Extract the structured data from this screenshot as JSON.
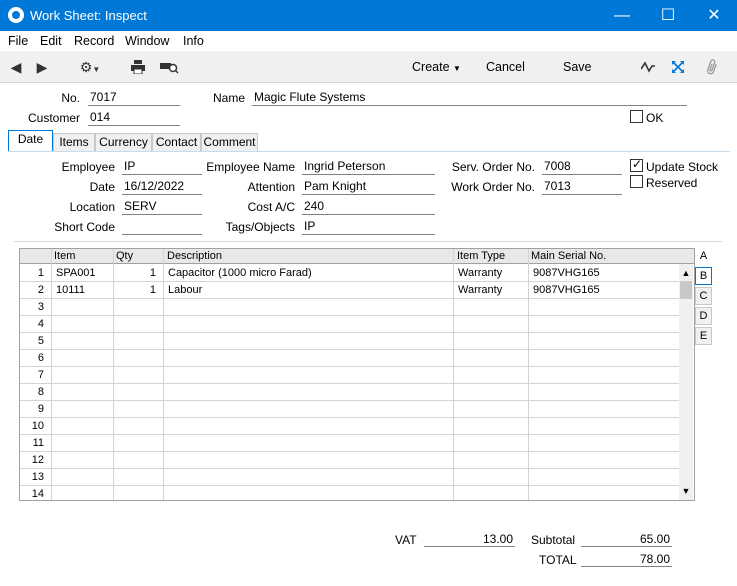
{
  "window": {
    "title": "Work Sheet: Inspect",
    "minimize": "—",
    "maximize": "☐",
    "close": "✕"
  },
  "menu": [
    "File",
    "Edit",
    "Record",
    "Window",
    "Info"
  ],
  "toolbar": {
    "create_label": "Create",
    "cancel_label": "Cancel",
    "save_label": "Save"
  },
  "header": {
    "no_label": "No.",
    "no_value": "7017",
    "name_label": "Name",
    "name_value": "Magic Flute Systems",
    "customer_label": "Customer",
    "customer_value": "014",
    "ok_label": "OK",
    "ok_checked": false
  },
  "tabs": [
    "Date",
    "Items",
    "Currency",
    "Contact",
    "Comment"
  ],
  "active_tab": "Date",
  "date_tab": {
    "employee_label": "Employee",
    "employee_value": "IP",
    "date_label": "Date",
    "date_value": "16/12/2022",
    "location_label": "Location",
    "location_value": "SERV",
    "short_code_label": "Short Code",
    "short_code_value": "",
    "employee_name_label": "Employee Name",
    "employee_name_value": "Ingrid Peterson",
    "attention_label": "Attention",
    "attention_value": "Pam Knight",
    "cost_ac_label": "Cost A/C",
    "cost_ac_value": "240",
    "tags_label": "Tags/Objects",
    "tags_value": "IP",
    "serv_order_label": "Serv. Order No.",
    "serv_order_value": "7008",
    "work_order_label": "Work Order No.",
    "work_order_value": "7013",
    "update_stock_label": "Update Stock",
    "update_stock_checked": true,
    "reserved_label": "Reserved",
    "reserved_checked": false
  },
  "grid": {
    "columns": [
      "Item",
      "Qty",
      "Description",
      "Item Type",
      "Main Serial No."
    ],
    "rows": [
      {
        "no": "1",
        "item": "SPA001",
        "qty": "1",
        "description": "Capacitor (1000 micro Farad)",
        "item_type": "Warranty",
        "serial": "9087VHG165"
      },
      {
        "no": "2",
        "item": "10111",
        "qty": "1",
        "description": "Labour",
        "item_type": "Warranty",
        "serial": "9087VHG165"
      },
      {
        "no": "3"
      },
      {
        "no": "4"
      },
      {
        "no": "5"
      },
      {
        "no": "6"
      },
      {
        "no": "7"
      },
      {
        "no": "8"
      },
      {
        "no": "9"
      },
      {
        "no": "10"
      },
      {
        "no": "11"
      },
      {
        "no": "12"
      },
      {
        "no": "13"
      },
      {
        "no": "14"
      }
    ],
    "side_tabs": [
      "A",
      "B",
      "C",
      "D",
      "E"
    ],
    "active_side_tab": "B",
    "scroll_up": "▲",
    "scroll_down": "▼"
  },
  "totals": {
    "vat_label": "VAT",
    "vat_value": "13.00",
    "subtotal_label": "Subtotal",
    "subtotal_value": "65.00",
    "total_label": "TOTAL",
    "total_value": "78.00"
  }
}
